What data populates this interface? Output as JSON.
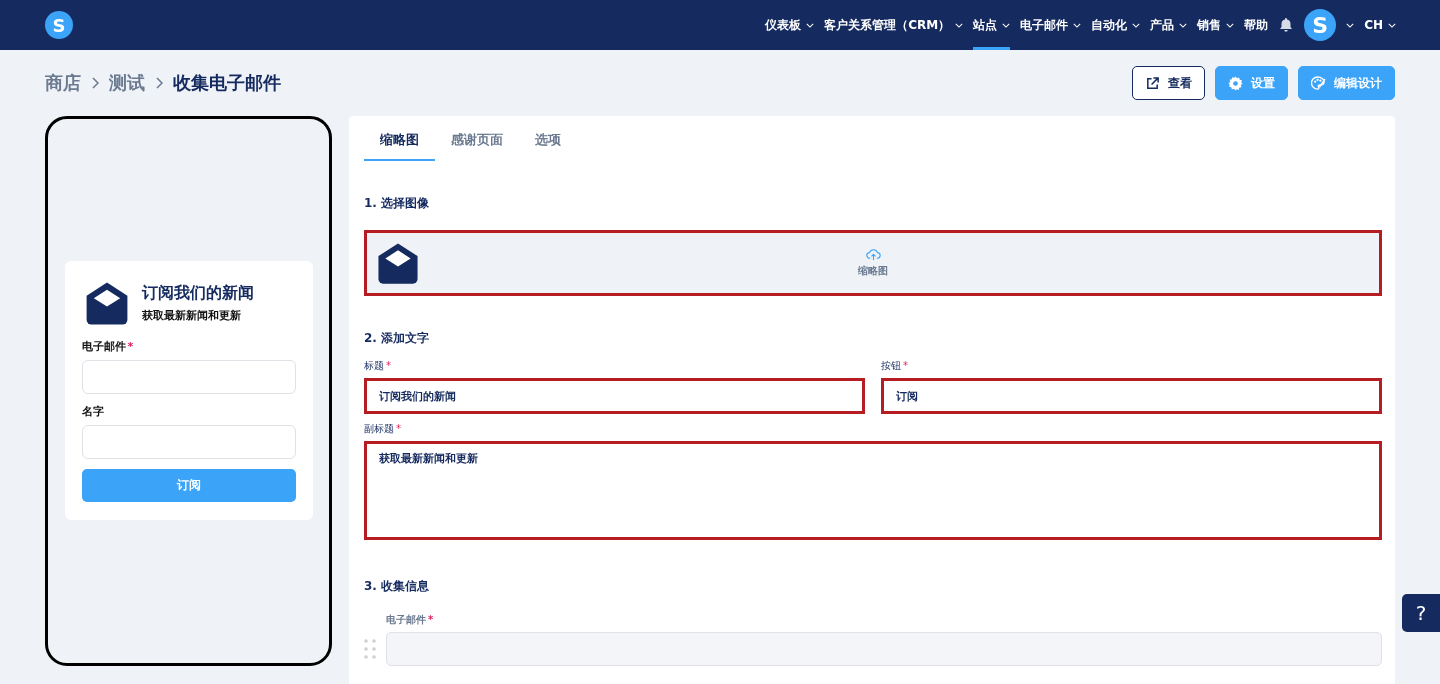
{
  "nav": {
    "logo": "S",
    "items": [
      {
        "label": "仪表板",
        "has_menu": true,
        "selected": false
      },
      {
        "label": "客户关系管理（CRM）",
        "has_menu": true,
        "selected": false
      },
      {
        "label": "站点",
        "has_menu": true,
        "selected": true
      },
      {
        "label": "电子邮件",
        "has_menu": true,
        "selected": false
      },
      {
        "label": "自动化",
        "has_menu": true,
        "selected": false
      },
      {
        "label": "产品",
        "has_menu": true,
        "selected": false
      },
      {
        "label": "销售",
        "has_menu": true,
        "selected": false
      },
      {
        "label": "帮助",
        "has_menu": false,
        "selected": false
      }
    ],
    "avatar": "S",
    "language": "CH"
  },
  "breadcrumb": [
    {
      "label": "商店",
      "current": false
    },
    {
      "label": "测试",
      "current": false
    },
    {
      "label": "收集电子邮件",
      "current": true
    }
  ],
  "actions": [
    {
      "label": "查看",
      "kind": "outline"
    },
    {
      "label": "设置",
      "kind": "settings"
    },
    {
      "label": "编辑设计",
      "kind": "design"
    }
  ],
  "preview": {
    "title": "订阅我们的新闻",
    "subtitle": "获取最新新闻和更新",
    "fields": [
      {
        "label": "电子邮件",
        "mark": "*"
      },
      {
        "label": "名字"
      }
    ],
    "button": "订阅"
  },
  "tabs": [
    {
      "label": "缩略图",
      "selected": true
    },
    {
      "label": "感谢页面",
      "selected": false
    },
    {
      "label": "选项",
      "selected": false
    }
  ],
  "sections": {
    "image": "1. 选择图像",
    "upload_label": "缩略图",
    "image_error": true,
    "text": "2. 添加文字",
    "collect": "3. 收集信息"
  },
  "text_fields": [
    {
      "label": "标题",
      "mark": "*",
      "value": "订阅我们的新闻",
      "error": true,
      "kind": "input"
    },
    {
      "label": "按钮",
      "mark": "*",
      "value": "订阅",
      "error": true,
      "kind": "input"
    },
    {
      "label": "副标题",
      "mark": "*",
      "value": "获取最新新闻和更新",
      "error": true,
      "kind": "textarea"
    }
  ],
  "collect_fields": [
    {
      "label": "电子邮件",
      "mark": "*"
    }
  ],
  "help": "?"
}
